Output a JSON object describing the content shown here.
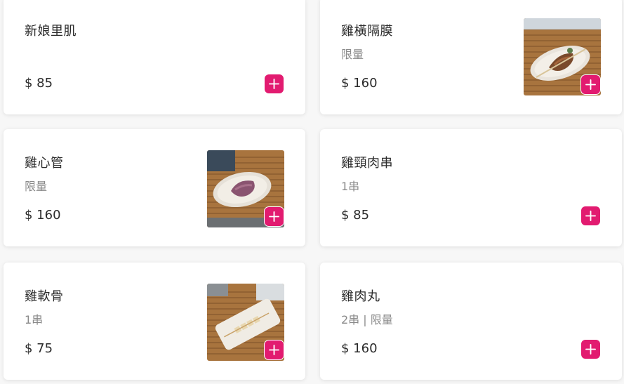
{
  "accent_color": "#e21b70",
  "items": [
    {
      "name": "新娘里肌",
      "desc": "",
      "price": "$ 85",
      "has_image": false
    },
    {
      "name": "雞橫隔膜",
      "desc": "限量",
      "price": "$ 160",
      "has_image": true
    },
    {
      "name": "雞心管",
      "desc": "限量",
      "price": "$ 160",
      "has_image": true
    },
    {
      "name": "雞頸肉串",
      "desc": "1串",
      "price": "$ 85",
      "has_image": false
    },
    {
      "name": "雞軟骨",
      "desc": "1串",
      "price": "$ 75",
      "has_image": true
    },
    {
      "name": "雞肉丸",
      "desc": "2串 | 限量",
      "price": "$ 160",
      "has_image": false
    }
  ],
  "add_button_icon": "plus-icon"
}
